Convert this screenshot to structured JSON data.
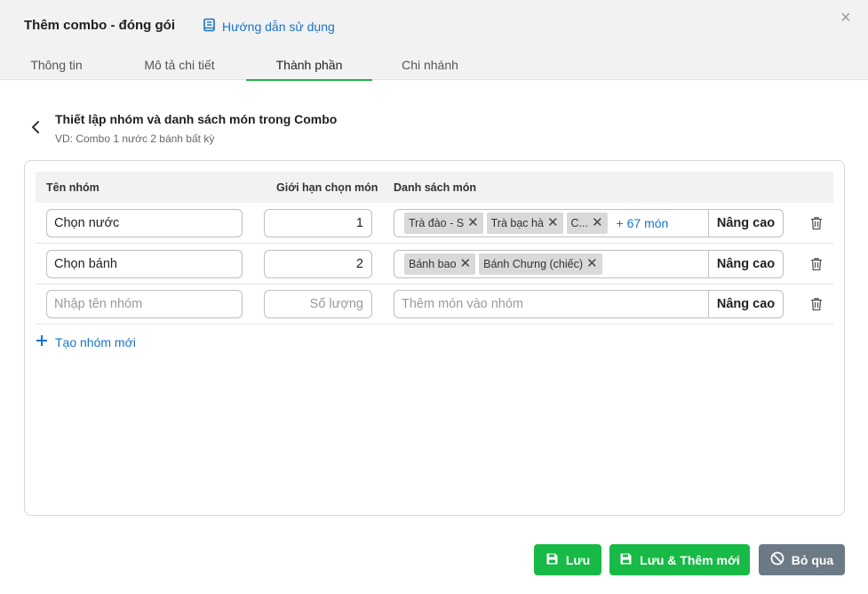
{
  "header": {
    "title": "Thêm combo - đóng gói",
    "guide_label": "Hướng dẫn sử dụng",
    "close": "×"
  },
  "tabs": [
    {
      "label": "Thông tin",
      "active": false
    },
    {
      "label": "Mô tả chi tiết",
      "active": false
    },
    {
      "label": "Thành phần",
      "active": true
    },
    {
      "label": "Chi nhánh",
      "active": false
    }
  ],
  "section": {
    "title": "Thiết lập nhóm và danh sách món trong Combo",
    "subtitle": "VD: Combo 1 nước 2 bánh bất kỳ"
  },
  "table": {
    "columns": [
      "Tên nhóm",
      "Giới hạn chọn món",
      "Danh sách món"
    ],
    "rows": [
      {
        "name": "Chọn nước",
        "limit": "1",
        "items": [
          "Trà đào - S",
          "Trà bạc hà",
          "C..."
        ],
        "more": "+ 67 món",
        "advanced": "Nâng cao"
      },
      {
        "name": "Chọn bánh",
        "limit": "2",
        "items": [
          "Bánh bao",
          "Bánh Chưng (chiếc)"
        ],
        "more": "",
        "advanced": "Nâng cao"
      }
    ],
    "new_row": {
      "name_placeholder": "Nhập tên nhóm",
      "limit_placeholder": "Số lượng",
      "items_placeholder": "Thêm món vào nhóm",
      "advanced": "Nâng cao"
    }
  },
  "add_group_label": "Tạo nhóm mới",
  "footer": {
    "save": "Lưu",
    "save_add": "Lưu & Thêm mới",
    "skip": "Bỏ qua"
  },
  "colors": {
    "primary_green": "#17ba46",
    "link_blue": "#1a73c8",
    "skip_gray": "#6c7a86",
    "tab_underline": "#24b34b"
  }
}
